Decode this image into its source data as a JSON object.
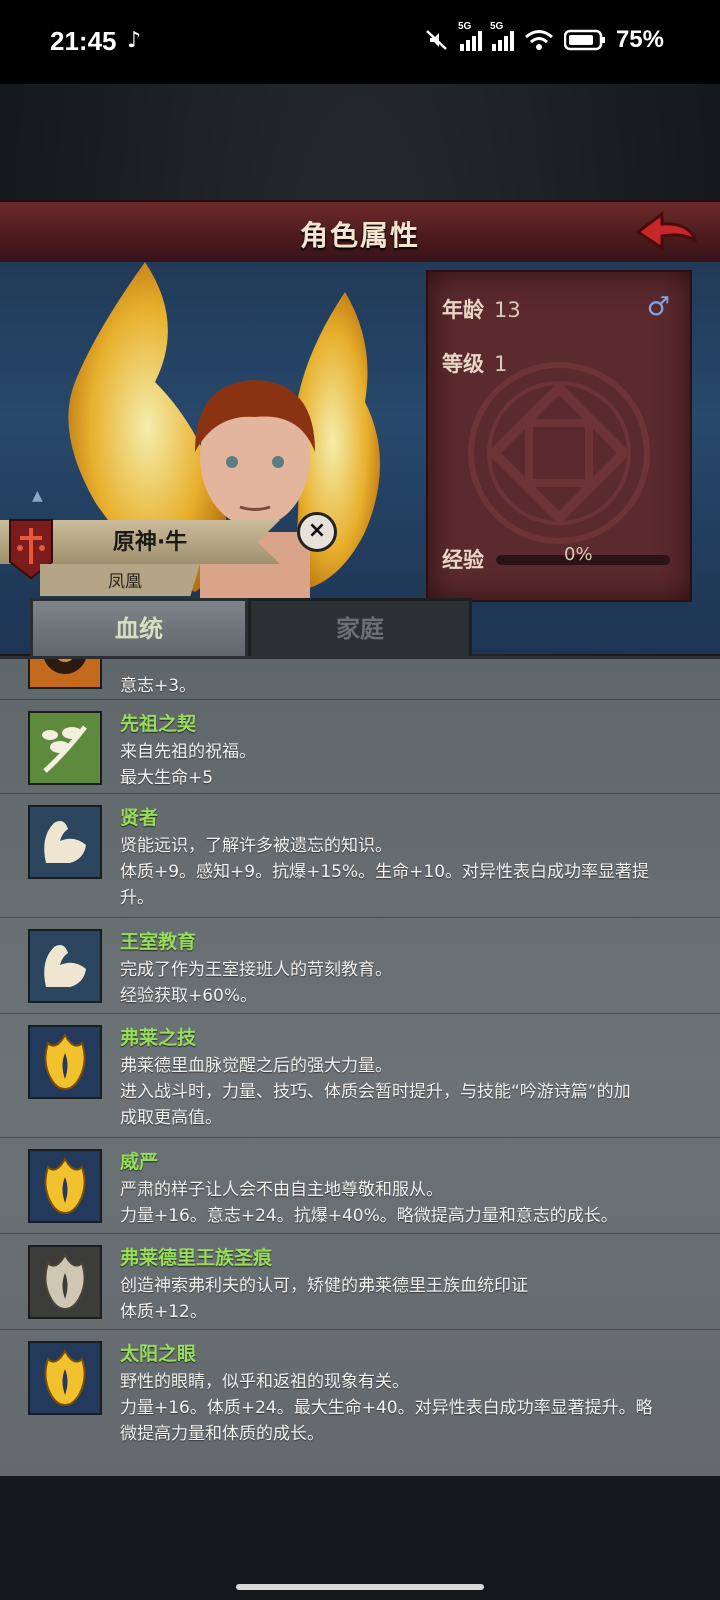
{
  "status_bar": {
    "time": "21:45",
    "network1": "5G",
    "network2": "5G",
    "battery": "75%"
  },
  "header": {
    "title": "角色属性"
  },
  "character": {
    "name": "原神·牛",
    "title": "凤凰",
    "age_label": "年龄",
    "age": "13",
    "level_label": "等级",
    "level": "1",
    "exp_label": "经验",
    "exp": "0%",
    "exp_fraction": 0,
    "gender_symbol": "♂"
  },
  "tabs": [
    {
      "label": "血统",
      "active": true
    },
    {
      "label": "家庭",
      "active": false
    }
  ],
  "traits": [
    {
      "title": "",
      "lines": [
        "意志+3。"
      ],
      "icon": "eye-icon"
    },
    {
      "title": "先祖之契",
      "lines": [
        "来自先祖的祝福。",
        "最大生命+5"
      ],
      "icon": "branch-icon"
    },
    {
      "title": "贤者",
      "lines": [
        "贤能远识，了解许多被遗忘的知识。",
        "体质+9。感知+9。抗爆+15%。生命+10。对异性表白成功率显著提",
        "升。"
      ],
      "icon": "arm-icon"
    },
    {
      "title": "王室教育",
      "lines": [
        "完成了作为王室接班人的苛刻教育。",
        "经验获取+60%。"
      ],
      "icon": "arm-icon"
    },
    {
      "title": "弗莱之技",
      "lines": [
        "弗莱德里血脉觉醒之后的强大力量。",
        "进入战斗时，力量、技巧、体质会暂时提升，与技能“吟游诗篇”的加",
        "成取更高值。"
      ],
      "icon": "flame-icon"
    },
    {
      "title": "威严",
      "lines": [
        "严肃的样子让人会不由自主地尊敬和服从。",
        "力量+16。意志+24。抗爆+40%。略微提高力量和意志的成长。"
      ],
      "icon": "flame-icon"
    },
    {
      "title": "弗莱德里王族圣痕",
      "lines": [
        "创造神索弗利夫的认可，矫健的弗莱德里王族血统印证",
        "体质+12。"
      ],
      "icon": "grey-flame-icon"
    },
    {
      "title": "太阳之眼",
      "lines": [
        "野性的眼睛，似乎和返祖的现象有关。",
        "力量+16。体质+24。最大生命+40。对异性表白成功率显著提升。略",
        "微提高力量和体质的成长。"
      ],
      "icon": "flame-icon"
    }
  ]
}
